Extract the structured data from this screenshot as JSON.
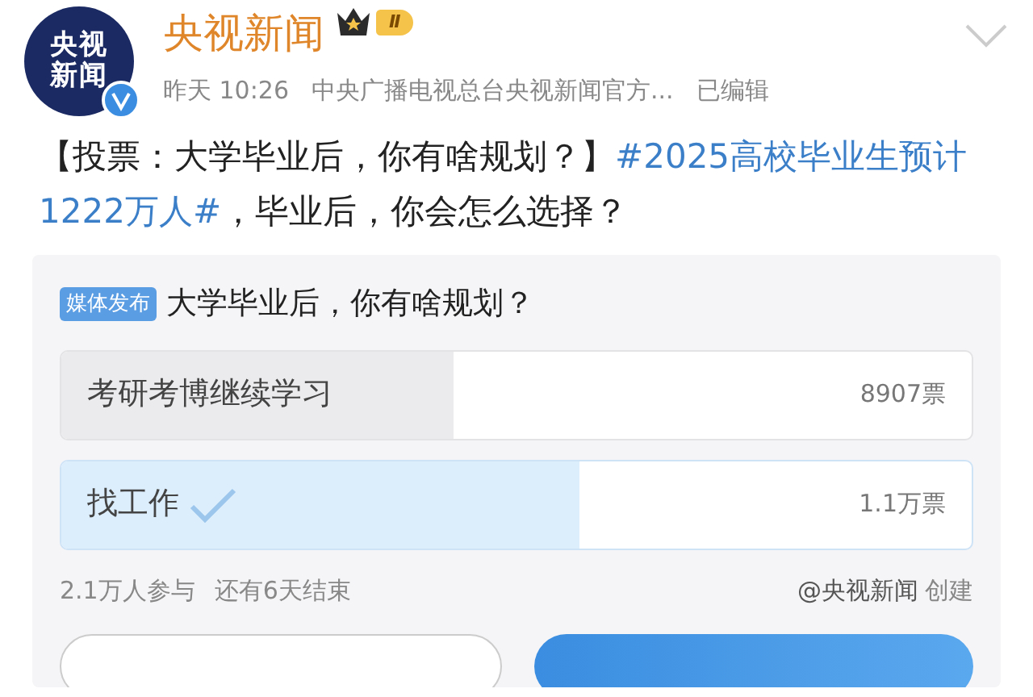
{
  "header": {
    "avatar_lines": [
      "央视",
      "新闻"
    ],
    "verified": true,
    "name": "央视新闻",
    "level_badge": "Ⅱ",
    "time": "昨天 10:26",
    "source": "中央广播电视总台央视新闻官方...",
    "edited": "已编辑"
  },
  "post": {
    "text": "【投票：大学毕业后，你有啥规划？】",
    "hashtag": "#2025高校毕业生预计1222万人#",
    "text_after": "，毕业后，你会怎么选择？"
  },
  "poll": {
    "tag": "媒体发布",
    "question": "大学毕业后，你有啥规划？",
    "options": [
      {
        "label": "考研考博继续学习",
        "votes": "8907票",
        "level": 0.43,
        "selected": false
      },
      {
        "label": "找工作",
        "votes": "1.1万票",
        "level": 0.57,
        "selected": true
      }
    ],
    "participants": "2.1万人参与",
    "remaining": "还有6天结束",
    "creator": "@央视新闻",
    "created": "创建",
    "buttons": [
      {
        "kind": "outline"
      },
      {
        "kind": "primary"
      }
    ]
  }
}
